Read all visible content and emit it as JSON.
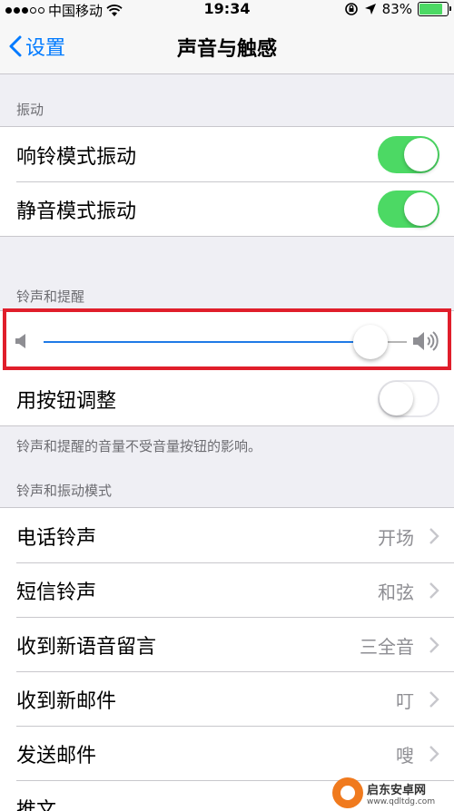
{
  "status_bar": {
    "carrier": "中国移动",
    "time": "19:34",
    "battery": "83%",
    "battery_level": 0.83,
    "battery_color": "#4cd964"
  },
  "nav": {
    "back_label": "设置",
    "title": "声音与触感"
  },
  "vibrate": {
    "header": "振动",
    "rows": [
      {
        "label": "响铃模式振动",
        "on": true
      },
      {
        "label": "静音模式振动",
        "on": true
      }
    ]
  },
  "ringer": {
    "header": "铃声和提醒",
    "volume_level": 0.9,
    "change_with_buttons_label": "用按钮调整",
    "change_with_buttons_on": false,
    "footer": "铃声和提醒的音量不受音量按钮的影响。"
  },
  "patterns": {
    "header": "铃声和振动模式",
    "rows": [
      {
        "label": "电话铃声",
        "value": "开场"
      },
      {
        "label": "短信铃声",
        "value": "和弦"
      },
      {
        "label": "收到新语音留言",
        "value": "三全音"
      },
      {
        "label": "收到新邮件",
        "value": "叮"
      },
      {
        "label": "发送邮件",
        "value": "嗖"
      },
      {
        "label": "推文",
        "value": ""
      }
    ]
  },
  "watermark": {
    "title": "启东安卓网",
    "url": "www.qdltdg.com"
  },
  "colors": {
    "accent": "#007aff",
    "switch_on": "#4cd964",
    "highlight": "#e01e2b"
  },
  "icons": [
    "back-chevron-icon",
    "wifi-icon",
    "rotation-lock-icon",
    "location-arrow-icon",
    "battery-icon",
    "speaker-low-icon",
    "speaker-high-icon",
    "chevron-right-icon"
  ]
}
